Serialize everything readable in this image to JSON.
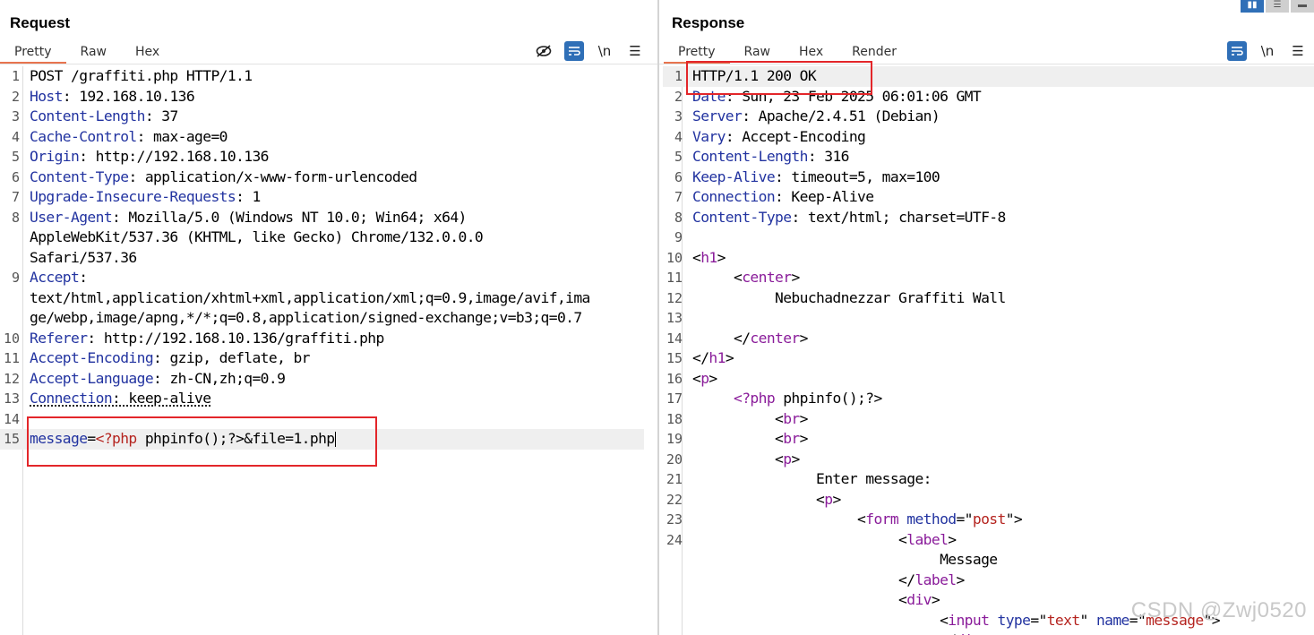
{
  "request": {
    "title": "Request",
    "tabs": [
      "Pretty",
      "Raw",
      "Hex"
    ],
    "active_tab": "Pretty",
    "tools": [
      "hide-icon",
      "wrap-icon",
      "\\n",
      "menu-icon"
    ]
  },
  "response": {
    "title": "Response",
    "tabs": [
      "Pretty",
      "Raw",
      "Hex",
      "Render"
    ],
    "active_tab": "Pretty",
    "tools": [
      "wrap-icon",
      "\\n",
      "menu-icon"
    ]
  },
  "layout_buttons": [
    "split-vertical-icon",
    "split-horizontal-icon",
    "single-icon"
  ],
  "watermark": "CSDN @Zwj0520",
  "colors": {
    "accent": "#e8744f",
    "keyword": "#2233a0",
    "tag": "#8a1c9a",
    "string": "#b5241f",
    "highlight": "#e3262a",
    "tool_blue": "#2f6fb7"
  }
}
